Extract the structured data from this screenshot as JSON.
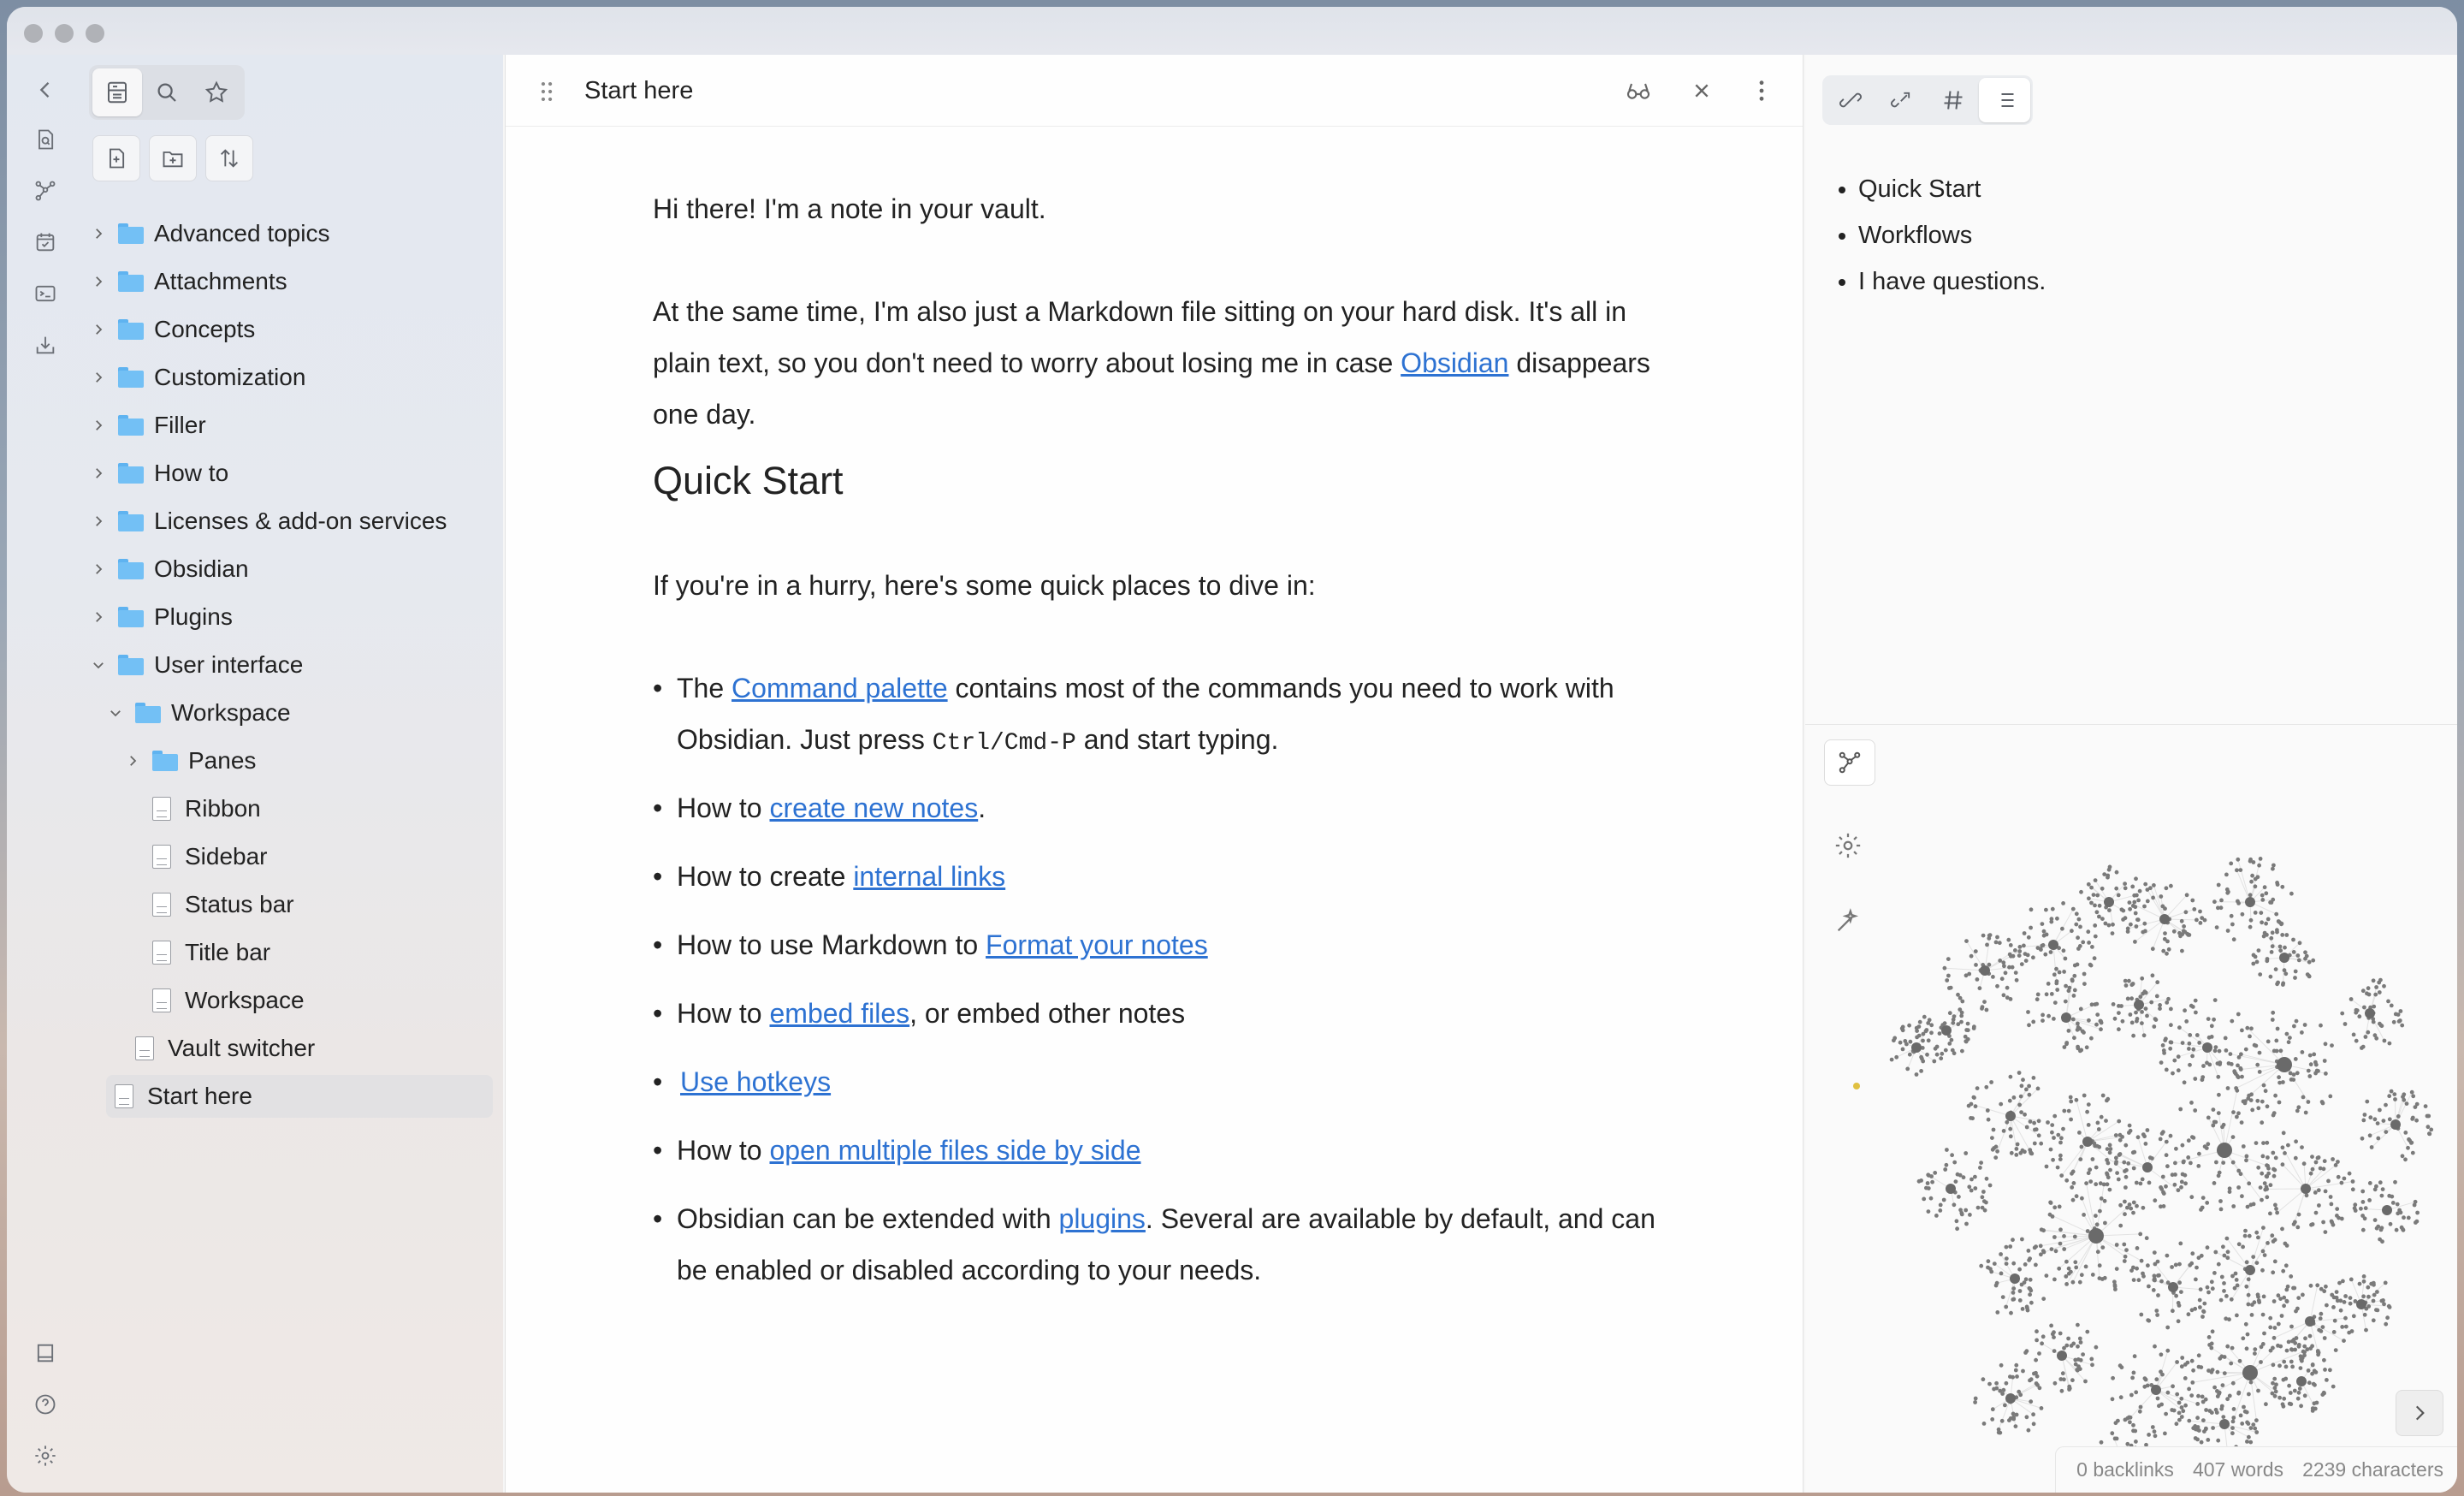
{
  "window": {
    "title": ""
  },
  "ribbon": {
    "items": [
      "collapse-left-icon",
      "open-quick-switcher-icon",
      "graph-view-icon",
      "daily-note-icon",
      "command-palette-icon",
      "import-icon"
    ],
    "bottom": [
      "vault-icon",
      "help-icon",
      "settings-icon"
    ]
  },
  "file_explorer": {
    "tabs": [
      "files",
      "search",
      "bookmarks"
    ],
    "actions": [
      "new-note",
      "new-folder",
      "change-sort-order"
    ],
    "tree": [
      {
        "label": "Advanced topics",
        "type": "folder",
        "level": 0,
        "expanded": false
      },
      {
        "label": "Attachments",
        "type": "folder",
        "level": 0,
        "expanded": false
      },
      {
        "label": "Concepts",
        "type": "folder",
        "level": 0,
        "expanded": false
      },
      {
        "label": "Customization",
        "type": "folder",
        "level": 0,
        "expanded": false
      },
      {
        "label": "Filler",
        "type": "folder",
        "level": 0,
        "expanded": false
      },
      {
        "label": "How to",
        "type": "folder",
        "level": 0,
        "expanded": false
      },
      {
        "label": "Licenses & add-on services",
        "type": "folder",
        "level": 0,
        "expanded": false
      },
      {
        "label": "Obsidian",
        "type": "folder",
        "level": 0,
        "expanded": false
      },
      {
        "label": "Plugins",
        "type": "folder",
        "level": 0,
        "expanded": false
      },
      {
        "label": "User interface",
        "type": "folder",
        "level": 0,
        "expanded": true
      },
      {
        "label": "Workspace",
        "type": "folder",
        "level": 1,
        "expanded": true
      },
      {
        "label": "Panes",
        "type": "folder",
        "level": 2,
        "expanded": false
      },
      {
        "label": "Ribbon",
        "type": "file",
        "level": 2
      },
      {
        "label": "Sidebar",
        "type": "file",
        "level": 2
      },
      {
        "label": "Status bar",
        "type": "file",
        "level": 2
      },
      {
        "label": "Title bar",
        "type": "file",
        "level": 2
      },
      {
        "label": "Workspace",
        "type": "file",
        "level": 2
      },
      {
        "label": "Vault switcher",
        "type": "file",
        "level": 1
      },
      {
        "label": "Start here",
        "type": "file",
        "level": 0,
        "selected": true
      }
    ]
  },
  "editor": {
    "tab_title": "Start here",
    "p1": "Hi there! I'm a note in your vault.",
    "p2_a": "At the same time, I'm also just a Markdown file sitting on your hard disk. It's all in plain text, so you don't need to worry about losing me in case ",
    "p2_link": "Obsidian",
    "p2_b": " disappears one day.",
    "h_quick": "Quick Start",
    "p3": "If you're in a hurry, here's some quick places to dive in:",
    "b1_a": "The ",
    "b1_link": "Command palette",
    "b1_b": "  contains most of the commands you need to work with Obsidian. Just press ",
    "b1_code": "Ctrl/Cmd-P",
    "b1_c": " and start typing.",
    "b2_a": "How to ",
    "b2_link": "create new notes",
    "b2_b": ".",
    "b3_a": "How to create ",
    "b3_link": "internal links",
    "b4_a": "How to use Markdown to ",
    "b4_link": "Format your notes",
    "b5_a": "How to ",
    "b5_link": "embed files",
    "b5_b": ", or embed other notes",
    "b6_link": "Use hotkeys",
    "b7_a": "How to ",
    "b7_link": "open multiple files side by side",
    "b8_a": "Obsidian can be extended with ",
    "b8_link": "plugins",
    "b8_b": ". Several are available by default, and can be enabled or disabled according to your needs."
  },
  "right_sidebar": {
    "tabs": [
      "backlinks",
      "outgoing-links",
      "tags",
      "outline"
    ],
    "outline": [
      "Quick Start",
      "Workflows",
      "I have questions."
    ]
  },
  "status": {
    "backlinks": "0 backlinks",
    "words": "407 words",
    "characters": "2239 characters"
  },
  "colors": {
    "accent": "#2d72d2",
    "folder": "#73c0f5"
  }
}
